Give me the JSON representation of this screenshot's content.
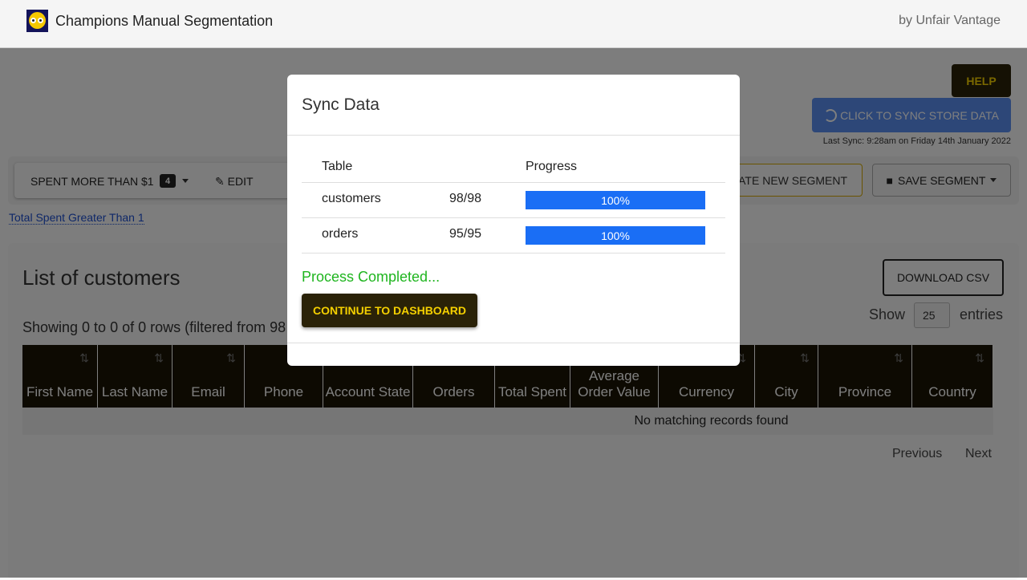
{
  "header": {
    "title": "Champions Manual Segmentation",
    "byline": "by Unfair Vantage"
  },
  "top": {
    "help": "Help",
    "sync": "Click to Sync Store Data",
    "last_sync": "Last Sync: 9:28am on Friday 14th January 2022"
  },
  "toolbar": {
    "segment": "SPENT MORE THAN $1",
    "segment_count": "4",
    "edit": "EDIT",
    "create": "CREATE NEW SEGMENT",
    "save": "SAVE SEGMENT"
  },
  "filter_link": "Total Spent Greater Than 1",
  "list": {
    "title": "List of customers",
    "download": "Download CSV",
    "show": "Show",
    "entries_value": "25",
    "entries": "entries",
    "showing": "Showing 0 to 0 of 0 rows (filtered from 98 total rows)",
    "columns": [
      "First Name",
      "Last Name",
      "Email",
      "Phone",
      "Account State",
      "Orders",
      "Total Spent",
      "Average Order Value",
      "Currency",
      "City",
      "Province",
      "Country"
    ],
    "empty": "No matching records found",
    "previous": "Previous",
    "next": "Next"
  },
  "modal": {
    "title": "Sync Data",
    "headers": {
      "table": "Table",
      "progress": "Progress"
    },
    "rows": [
      {
        "table": "customers",
        "count": "98/98",
        "progress": 100,
        "label": "100%"
      },
      {
        "table": "orders",
        "count": "95/95",
        "progress": 100,
        "label": "100%"
      }
    ],
    "status": "Process Completed...",
    "continue": "Continue to Dashboard"
  },
  "colors": {
    "accent": "#f5d000",
    "dark": "#2a2208",
    "progress": "#1a6ef5",
    "success": "#1fb51f",
    "sync": "#5b8ef0"
  }
}
